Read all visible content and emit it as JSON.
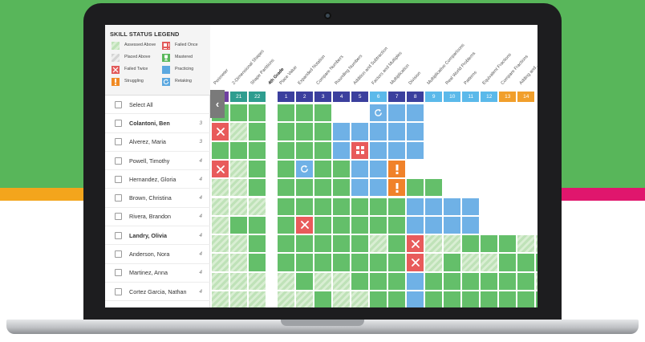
{
  "legend": {
    "title": "SKILL STATUS LEGEND",
    "items": [
      {
        "label": "Assessed Above",
        "icon": "hatched-swatch",
        "color": "#dfeeda"
      },
      {
        "label": "Failed Once",
        "icon": "failed-once-icon",
        "color": "#e25a5a"
      },
      {
        "label": "Placed Above",
        "icon": "hatched-swatch",
        "color": "#e4e4e4"
      },
      {
        "label": "Mastered",
        "icon": "trophy-icon",
        "color": "#5ab85c"
      },
      {
        "label": "Failed Twice",
        "icon": "x-icon",
        "color": "#e25a5a"
      },
      {
        "label": "Practicing",
        "icon": "blue-square",
        "color": "#5ba8e0"
      },
      {
        "label": "Struggling",
        "icon": "exclamation-icon",
        "color": "#f08a24"
      },
      {
        "label": "Retaking",
        "icon": "retake-icon",
        "color": "#5ba8e0"
      }
    ]
  },
  "select_all": "Select All",
  "students": [
    {
      "name": "Colantoni, Ben",
      "count": "3",
      "bold": true
    },
    {
      "name": "Alverez, Maria",
      "count": "3",
      "bold": false
    },
    {
      "name": "Powell, Timothy",
      "count": "4",
      "bold": false
    },
    {
      "name": "Hernandez, Gloria",
      "count": "4",
      "bold": false
    },
    {
      "name": "Brown, Christina",
      "count": "4",
      "bold": false
    },
    {
      "name": "Rivera, Brandon",
      "count": "4",
      "bold": false
    },
    {
      "name": "Landry, Olivia",
      "count": "4",
      "bold": true
    },
    {
      "name": "Anderson, Nora",
      "count": "4",
      "bold": false
    },
    {
      "name": "Martinez, Anna",
      "count": "4",
      "bold": false
    },
    {
      "name": "Cortez Garcia, Nathan",
      "count": "4",
      "bold": false
    }
  ],
  "skill_headers": [
    "Perimeter",
    "2-Dimensional Shapes",
    "Shape Partitions",
    "4th Grade",
    "Place Value",
    "Expanded Notation",
    "Compare Numbers",
    "Rounding Numbers",
    "Addition and Subtraction",
    "Factors and Multiples",
    "Multiplication",
    "Division",
    "Multiplicative Comparisons",
    "Real World Problems",
    "Patterns",
    "Equivalent Fractions",
    "Compare Fractions",
    "Adding and..."
  ],
  "skill_numbers": [
    {
      "label": "20",
      "color": "#6f3fa0"
    },
    {
      "label": "21",
      "color": "#2e9d8f"
    },
    {
      "label": "22",
      "color": "#2e9d8f"
    },
    {
      "label": "1",
      "color": "#3b3f9e"
    },
    {
      "label": "2",
      "color": "#3b3f9e"
    },
    {
      "label": "3",
      "color": "#3b3f9e"
    },
    {
      "label": "4",
      "color": "#3b3f9e"
    },
    {
      "label": "5",
      "color": "#3b3f9e"
    },
    {
      "label": "6",
      "color": "#5bb9ea"
    },
    {
      "label": "7",
      "color": "#3b3f9e"
    },
    {
      "label": "8",
      "color": "#3b3f9e"
    },
    {
      "label": "9",
      "color": "#5bb9ea"
    },
    {
      "label": "10",
      "color": "#5bb9ea"
    },
    {
      "label": "11",
      "color": "#5bb9ea"
    },
    {
      "label": "12",
      "color": "#5bb9ea"
    },
    {
      "label": "13",
      "color": "#f19f2b"
    },
    {
      "label": "14",
      "color": "#f19f2b"
    }
  ],
  "grid_rows": [
    "GGG.GGG..RBB.......",
    "XHG.GGGBBBBB.......",
    "GGG.GGGBFBBB.......",
    "XHG.GTGGBBS........",
    "HHG.GGGGBBSGG......",
    "HHH.GGGGGGGBBBB....",
    "HGG.GXGGGGGBBBB....",
    "HHG.GGGGGHGXHHGGGHH",
    "HHG.GGGGGGGXHGHHGGG",
    "HHH.HGHHGGGBGGGGGGH",
    "HHH.HHGHHGGBGGGGGGG"
  ],
  "colors": {
    "mastered": "#64bf6a",
    "practicing": "#6fb1e6",
    "failed": "#e85b5b",
    "struggling": "#f0822a",
    "hatched": "#bfe2b8",
    "empty": "#f5f5f5",
    "green_bg": "#58b65a",
    "orange_strip": "#f3a51c",
    "pink_strip": "#e0166d"
  }
}
